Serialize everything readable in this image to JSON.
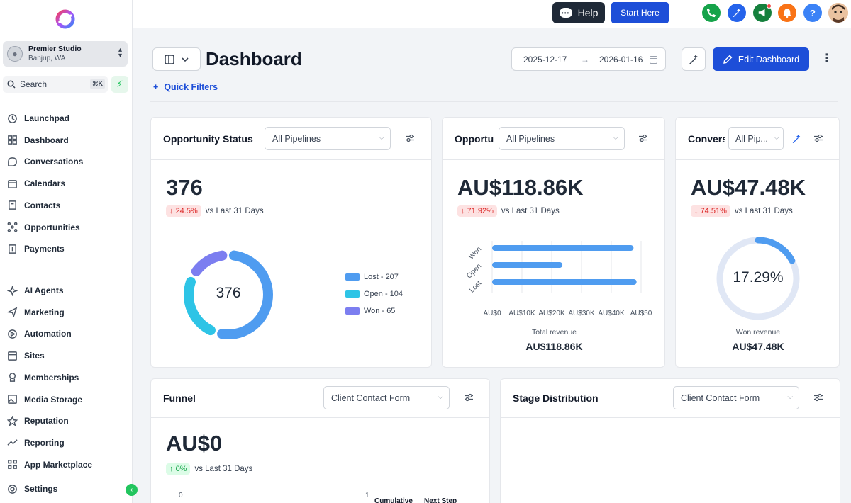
{
  "sidebar": {
    "account": {
      "name": "Premier Studio",
      "location": "Banjup, WA"
    },
    "search": {
      "label": "Search",
      "shortcut": "⌘K"
    },
    "items_top": [
      {
        "label": "Launchpad",
        "icon": "launchpad-icon"
      },
      {
        "label": "Dashboard",
        "icon": "dashboard-icon"
      },
      {
        "label": "Conversations",
        "icon": "chat-icon"
      },
      {
        "label": "Calendars",
        "icon": "calendar-icon"
      },
      {
        "label": "Contacts",
        "icon": "contacts-icon"
      },
      {
        "label": "Opportunities",
        "icon": "opportunities-icon"
      },
      {
        "label": "Payments",
        "icon": "payments-icon"
      }
    ],
    "items_bottom": [
      {
        "label": "AI Agents",
        "icon": "sparkle-icon"
      },
      {
        "label": "Marketing",
        "icon": "send-icon"
      },
      {
        "label": "Automation",
        "icon": "automation-icon"
      },
      {
        "label": "Sites",
        "icon": "sites-icon"
      },
      {
        "label": "Memberships",
        "icon": "memberships-icon"
      },
      {
        "label": "Media Storage",
        "icon": "image-icon"
      },
      {
        "label": "Reputation",
        "icon": "star-icon"
      },
      {
        "label": "Reporting",
        "icon": "trend-icon"
      },
      {
        "label": "App Marketplace",
        "icon": "grid-icon"
      }
    ],
    "settings": "Settings"
  },
  "topbar": {
    "help_label": "Help",
    "start_here_label": "Start Here",
    "colors": {
      "phone": "#16a34a",
      "magic": "#2563eb",
      "megaphone": "#15803d",
      "bell": "#f97316",
      "help": "#3b82f6"
    }
  },
  "header": {
    "title": "Dashboard",
    "date_from": "2025-12-17",
    "date_to": "2026-01-16",
    "edit_label": "Edit Dashboard",
    "quick_filters": "Quick Filters"
  },
  "cards": {
    "opp_status": {
      "title": "Opportunity Status",
      "select": "All Pipelines",
      "value": "376",
      "change": "24.5%",
      "compare": "vs Last 31 Days",
      "center": "376",
      "legend": [
        "Lost - 207",
        "Open - 104",
        "Won - 65"
      ]
    },
    "opp_value": {
      "title": "Opportu",
      "select": "All Pipelines",
      "value": "AU$118.86K",
      "change": "71.92%",
      "compare": "vs Last 31 Days",
      "caption": "Total revenue",
      "total": "AU$118.86K"
    },
    "conversion": {
      "title": "Convers",
      "select": "All Pip...",
      "value": "AU$47.48K",
      "change": "74.51%",
      "compare": "vs Last 31 Days",
      "center": "17.29%",
      "caption": "Won revenue",
      "total": "AU$47.48K"
    },
    "funnel": {
      "title": "Funnel",
      "select": "Client Contact Form",
      "value": "AU$0",
      "change": "0%",
      "compare": "vs Last 31 Days",
      "axis_left": "0",
      "axis_right": "1",
      "col1": "Cumulative",
      "col2": "Next Step"
    },
    "stage": {
      "title": "Stage Distribution",
      "select": "Client Contact Form"
    }
  },
  "chart_data": [
    {
      "type": "pie",
      "categories": [
        "Lost",
        "Open",
        "Won"
      ],
      "values": [
        207,
        104,
        65
      ],
      "colors": [
        "#4f9cf0",
        "#2ec4e6",
        "#7c7ef0"
      ]
    },
    {
      "type": "bar",
      "orientation": "horizontal",
      "categories": [
        "Won",
        "Open",
        "Lost"
      ],
      "values": [
        47480,
        23600,
        48500
      ],
      "xlim": [
        0,
        50000
      ],
      "xticks": [
        "AU$0",
        "AU$10K",
        "AU$20K",
        "AU$30K",
        "AU$40K",
        "AU$50"
      ],
      "color": "#4f9cf0"
    },
    {
      "type": "pie",
      "variant": "progress-ring",
      "values": [
        17.29
      ],
      "colors": [
        "#4f9cf0",
        "#e0e7f5"
      ]
    }
  ]
}
